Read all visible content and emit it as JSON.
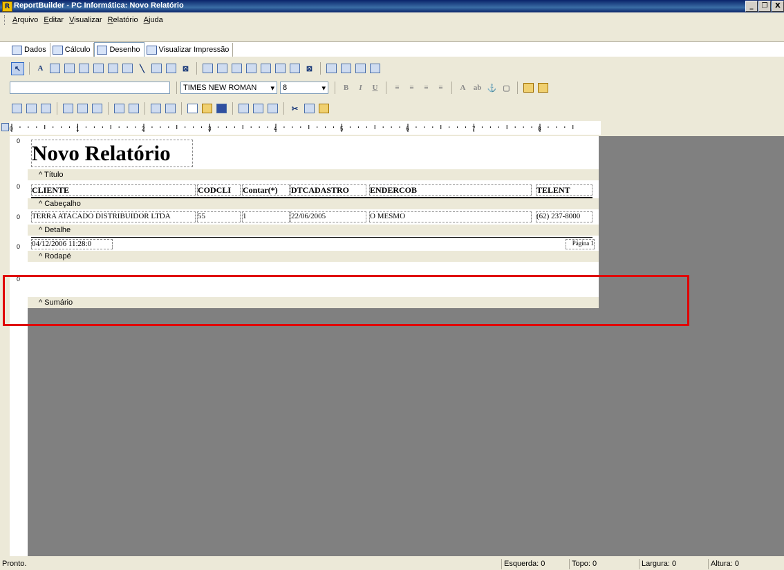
{
  "window": {
    "title": "ReportBuilder - PC Informática: Novo Relatório",
    "app_icon": "R"
  },
  "window_buttons": [
    "_",
    "❐",
    "X"
  ],
  "menu": [
    "Arquivo",
    "Editar",
    "Visualizar",
    "Relatório",
    "Ajuda"
  ],
  "tabs": [
    {
      "label": "Dados"
    },
    {
      "label": "Cálculo"
    },
    {
      "label": "Desenho"
    },
    {
      "label": "Visualizar Impressão"
    }
  ],
  "format_toolbar": {
    "font_name": "TIMES NEW ROMAN",
    "font_size": "8",
    "bold": "B",
    "italic": "I",
    "underline": "U"
  },
  "ruler_numbers": [
    "0",
    "1",
    "2",
    "3",
    "4",
    "5",
    "6",
    "7",
    "8"
  ],
  "report": {
    "title_text": "Novo Relatório",
    "bands": {
      "title": "^ Título",
      "header": "^ Cabeçalho",
      "detail": "^ Detalhe",
      "footer": "^ Rodapé",
      "summary": "^ Sumário"
    },
    "header_fields": [
      "CLIENTE",
      "CODCLI",
      "Contar(*)",
      "DTCADASTRO",
      "ENDERCOB",
      "TELENT"
    ],
    "detail_fields": [
      "TERRA ATACADO DISTRIBUIDOR LTDA",
      "55",
      "1",
      "22/06/2005",
      "O MESMO",
      "(62) 237-8000"
    ],
    "footer_fields": {
      "datetime": "04/12/2006 11:28:0",
      "page": "Página 1"
    },
    "gutter_mark": "0"
  },
  "status": {
    "text": "Pronto.",
    "esquerda": "Esquerda: 0",
    "topo": "Topo: 0",
    "largura": "Largura: 0",
    "altura": "Altura: 0"
  },
  "colors": {
    "highlight_box": "#e00000",
    "canvas_bg": "#808080",
    "titlebar": "#0a246a"
  }
}
